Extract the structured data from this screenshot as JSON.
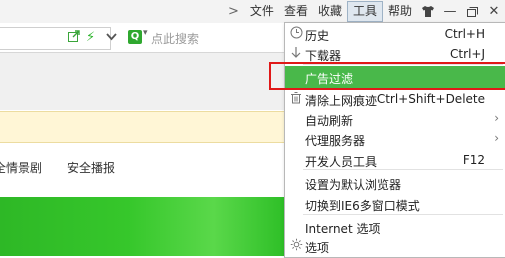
{
  "menubar": {
    "items": [
      "文件",
      "查看",
      "收藏",
      "工具",
      "帮助"
    ],
    "active": "工具"
  },
  "search": {
    "logo_letter": "Q",
    "placeholder": "点此搜索"
  },
  "content": {
    "nav_links": [
      "全情景剧",
      "安全播报"
    ]
  },
  "colors": {
    "accent_green": "#49b84a",
    "highlight_border": "#e01818",
    "banner_green": "#36c72b"
  },
  "dropdown": {
    "items": [
      {
        "label": "历史",
        "shortcut": "Ctrl+H",
        "icon": "history-clock-icon"
      },
      {
        "label": "下载器",
        "shortcut": "Ctrl+J",
        "icon": "download-arrow-icon"
      },
      {
        "label": "广告过滤",
        "shortcut": "",
        "highlighted": true
      },
      {
        "label": "清除上网痕迹",
        "shortcut": "Ctrl+Shift+Delete",
        "icon": "trash-icon"
      },
      {
        "label": "自动刷新",
        "submenu": true
      },
      {
        "label": "代理服务器",
        "submenu": true
      },
      {
        "label": "开发人员工具",
        "shortcut": "F12"
      },
      {
        "label": "设置为默认浏览器"
      },
      {
        "label": "切换到IE6多窗口模式"
      },
      {
        "label": "Internet 选项"
      },
      {
        "label": "选项",
        "icon": "gear-icon"
      }
    ]
  }
}
